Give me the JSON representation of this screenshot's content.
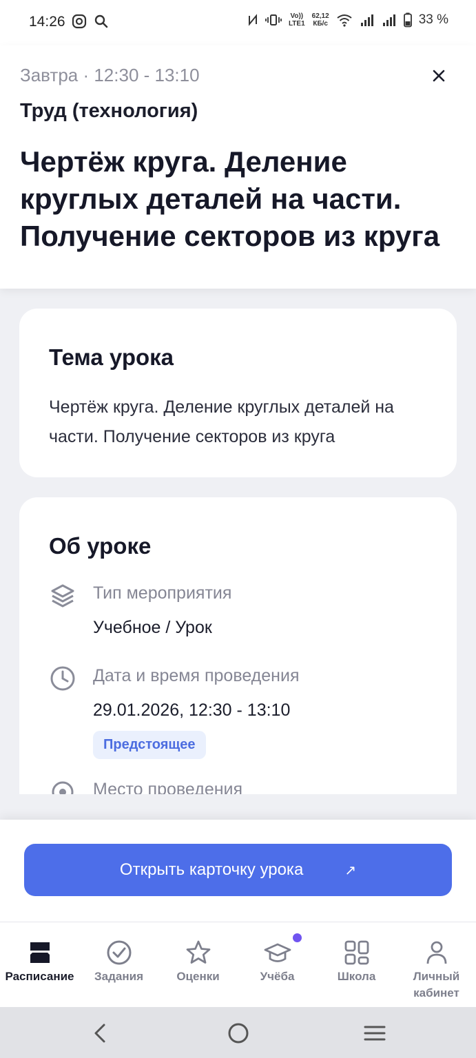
{
  "status_bar": {
    "time": "14:26",
    "network_speed_top": "62,12",
    "network_speed_bottom": "КБ/с",
    "volte_top": "Vo))",
    "volte_bottom": "LTE1",
    "battery": "33 %"
  },
  "header": {
    "when": "Завтра · 12:30 - 13:10",
    "subject": "Труд (технология)",
    "title": "Чертёж круга. Деление круглых деталей на части. Получение секторов из круга"
  },
  "topic_card": {
    "title": "Тема урока",
    "text": "Чертёж круга. Деление круглых деталей на части. Получение секторов из круга"
  },
  "about_card": {
    "title": "Об уроке",
    "rows": [
      {
        "icon": "layers-icon",
        "label": "Тип мероприятия",
        "value": "Учебное / Урок"
      },
      {
        "icon": "clock-icon",
        "label": "Дата и время проведения",
        "value": "29.01.2026, 12:30 - 13:10",
        "badge": "Предстоящее"
      },
      {
        "icon": "location-icon",
        "label": "Место проведения"
      }
    ]
  },
  "action": {
    "open_card_label": "Открыть карточку урока",
    "arrow": "↗"
  },
  "bottom_nav": {
    "items": [
      {
        "label": "Расписание",
        "icon": "schedule-icon",
        "active": true
      },
      {
        "label": "Задания",
        "icon": "check-circle-icon"
      },
      {
        "label": "Оценки",
        "icon": "star-icon"
      },
      {
        "label": "Учёба",
        "icon": "graduation-cap-icon",
        "has_notification": true
      },
      {
        "label": "Школа",
        "icon": "grid-icon"
      },
      {
        "label": "Личный кабинет",
        "icon": "person-icon"
      }
    ]
  },
  "colors": {
    "accent": "#4d6ee9",
    "badge_bg": "#eaf0fd",
    "badge_text": "#4c6de0",
    "notification_dot": "#7054f0",
    "background": "#eff0f4"
  }
}
